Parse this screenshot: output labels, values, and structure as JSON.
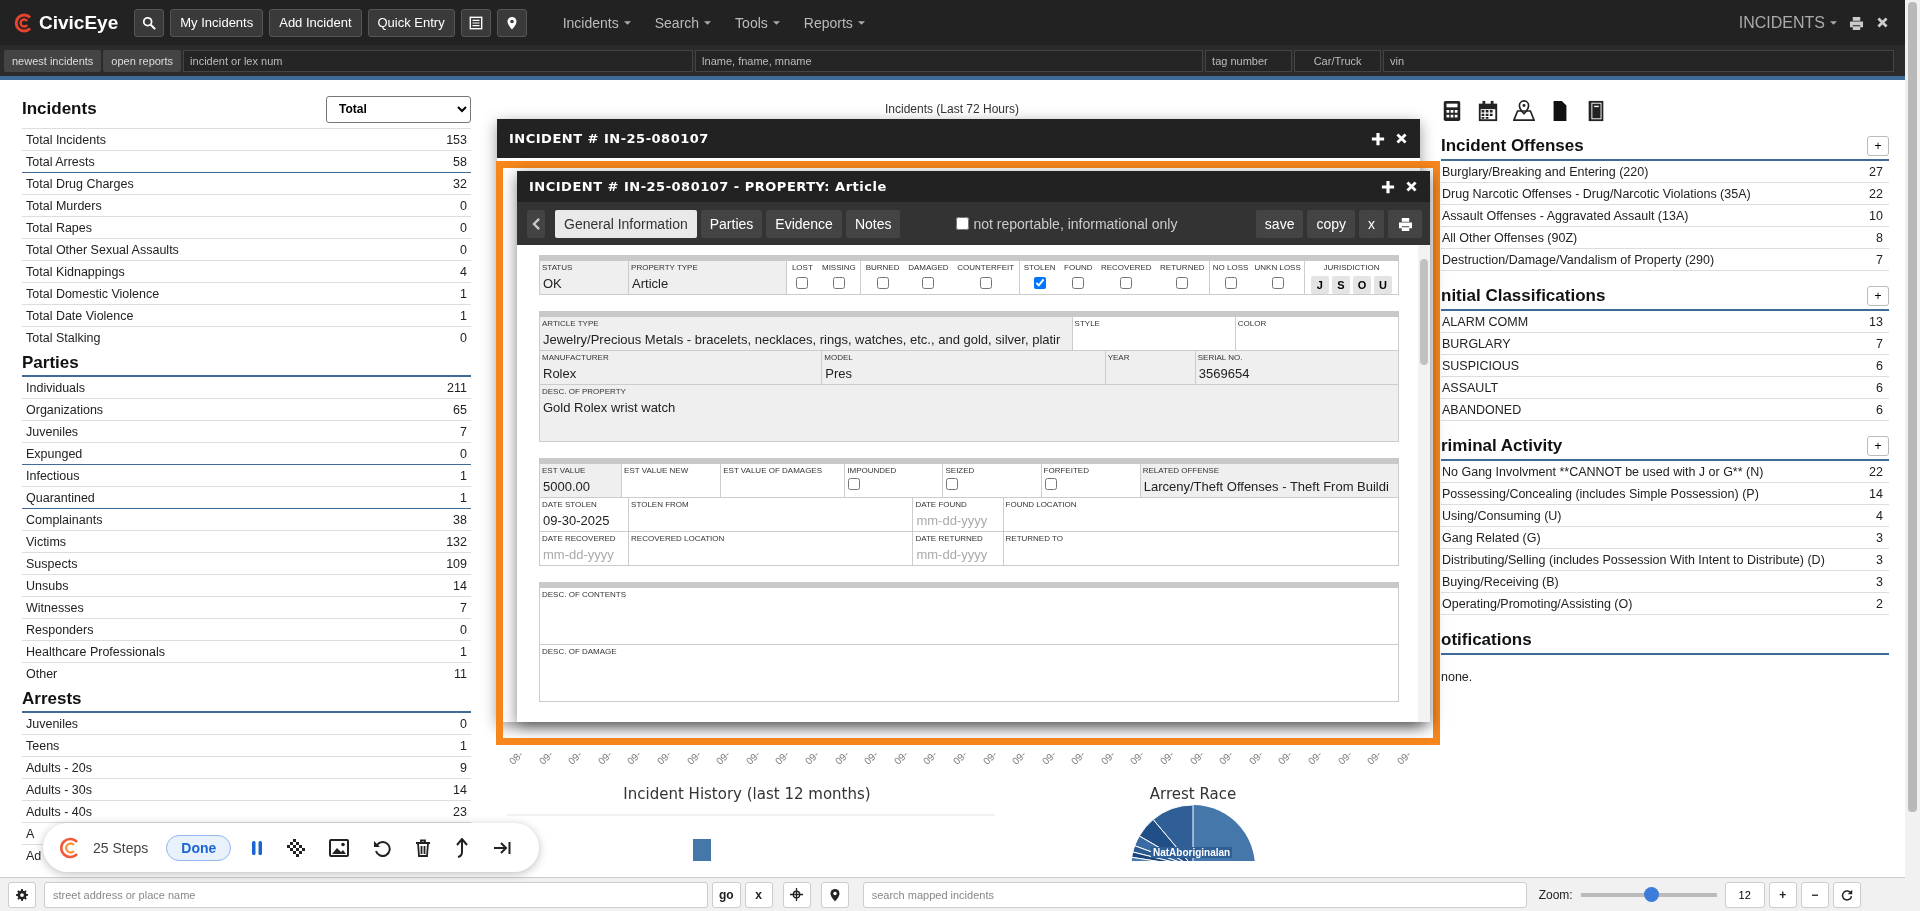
{
  "nav": {
    "logo": "CivicEye",
    "buttons": [
      "My Incidents",
      "Add Incident",
      "Quick Entry"
    ],
    "menus": [
      "Incidents",
      "Search",
      "Tools",
      "Reports"
    ],
    "module": "INCIDENTS"
  },
  "quick_search": {
    "buttons": [
      "newest incidents",
      "open reports"
    ],
    "fields": [
      {
        "placeholder": "incident or lex num"
      },
      {
        "placeholder": "lname, fname, mname"
      },
      {
        "placeholder": "tag number"
      },
      {
        "placeholder": "Car/Truck"
      },
      {
        "placeholder": "vin"
      }
    ]
  },
  "left_panel": {
    "sections": [
      {
        "title": "Incidents",
        "select": "Total",
        "underlined": false,
        "groups": [
          [
            {
              "label": "Total Incidents",
              "value": "153"
            },
            {
              "label": "Total Arrests",
              "value": "58"
            }
          ],
          [
            {
              "label": "Total Drug Charges",
              "value": "32"
            },
            {
              "label": "Total Murders",
              "value": "0"
            },
            {
              "label": "Total Rapes",
              "value": "0"
            },
            {
              "label": "Total Other Sexual Assaults",
              "value": "0"
            },
            {
              "label": "Total Kidnappings",
              "value": "4"
            },
            {
              "label": "Total Domestic Violence",
              "value": "1"
            },
            {
              "label": "Total Date Violence",
              "value": "1"
            },
            {
              "label": "Total Stalking",
              "value": "0"
            }
          ]
        ]
      },
      {
        "title": "Parties",
        "underlined": true,
        "groups": [
          [
            {
              "label": "Individuals",
              "value": "211"
            },
            {
              "label": "Organizations",
              "value": "65"
            },
            {
              "label": "Juveniles",
              "value": "7"
            },
            {
              "label": "Expunged",
              "value": "0"
            }
          ],
          [
            {
              "label": "Infectious",
              "value": "1"
            },
            {
              "label": "Quarantined",
              "value": "1"
            }
          ],
          [
            {
              "label": "Complainants",
              "value": "38"
            },
            {
              "label": "Victims",
              "value": "132"
            },
            {
              "label": "Suspects",
              "value": "109"
            },
            {
              "label": "Unsubs",
              "value": "14"
            },
            {
              "label": "Witnesses",
              "value": "7"
            },
            {
              "label": "Responders",
              "value": "0"
            },
            {
              "label": "Healthcare Professionals",
              "value": "1"
            },
            {
              "label": "Other",
              "value": "11"
            }
          ]
        ]
      },
      {
        "title": "Arrests",
        "underlined": true,
        "groups": [
          [
            {
              "label": "Juveniles",
              "value": "0"
            },
            {
              "label": "Teens",
              "value": "1"
            },
            {
              "label": "Adults - 20s",
              "value": "9"
            },
            {
              "label": "Adults - 30s",
              "value": "14"
            },
            {
              "label": "Adults - 40s",
              "value": "23"
            },
            {
              "label": "A"
            },
            {
              "label": "Ad"
            }
          ]
        ]
      }
    ]
  },
  "center": {
    "chart_title": "Incidents (Last 72 Hours)",
    "x_labels": [
      "08-",
      "09-",
      "09-",
      "09-",
      "09-",
      "09-",
      "09-",
      "09-",
      "09-",
      "09-",
      "09-",
      "09-",
      "09-",
      "09-",
      "09-",
      "09-",
      "09-",
      "09-",
      "09-",
      "09-",
      "09-",
      "09-",
      "09-",
      "09-",
      "09-",
      "09-",
      "09-",
      "09-",
      "09-",
      "09-",
      "09-"
    ],
    "history_title": "Incident History (last 12 months)",
    "race_title": "Arrest Race",
    "race_label": "NatAboriginalan"
  },
  "right_panel": {
    "sections": [
      {
        "title": "Incident Offenses",
        "add": "+",
        "rows": [
          {
            "label": "Burglary/Breaking and Entering (220)",
            "value": "27"
          },
          {
            "label": "Drug Narcotic Offenses - Drug/Narcotic Violations (35A)",
            "value": "22"
          },
          {
            "label": "Assault Offenses - Aggravated Assault (13A)",
            "value": "10"
          },
          {
            "label": "All Other Offenses (90Z)",
            "value": "8"
          },
          {
            "label": "Destruction/Damage/Vandalism of Property (290)",
            "value": "7"
          }
        ]
      },
      {
        "title": "nitial Classifications",
        "add": "+",
        "rows": [
          {
            "label": "ALARM COMM",
            "value": "13"
          },
          {
            "label": "BURGLARY",
            "value": "7"
          },
          {
            "label": "SUSPICIOUS",
            "value": "6"
          },
          {
            "label": "ASSAULT",
            "value": "6"
          },
          {
            "label": "ABANDONED",
            "value": "6"
          }
        ]
      },
      {
        "title": "riminal Activity",
        "add": "+",
        "rows": [
          {
            "label": "No Gang Involvment **CANNOT be used with J or G** (N)",
            "value": "22"
          },
          {
            "label": "Possessing/Concealing (includes Simple Possession) (P)",
            "value": "14"
          },
          {
            "label": "Using/Consuming (U)",
            "value": "4"
          },
          {
            "label": "Gang Related (G)",
            "value": "3"
          },
          {
            "label": "Distributing/Selling (includes Possession With Intent to Distribute) (D)",
            "value": "3"
          },
          {
            "label": "Buying/Receiving (B)",
            "value": "3"
          },
          {
            "label": "Operating/Promoting/Assisting (O)",
            "value": "2"
          }
        ]
      }
    ],
    "notifications": {
      "title": "otifications",
      "text": "none."
    }
  },
  "incident_window": {
    "title": "INCIDENT # IN-25-080107"
  },
  "property_window": {
    "title": "INCIDENT # IN-25-080107 - PROPERTY: Article",
    "tabs": [
      {
        "label": "General Information",
        "selected": true
      },
      {
        "label": "Parties",
        "selected": false
      },
      {
        "label": "Evidence",
        "selected": false
      },
      {
        "label": "Notes",
        "selected": false
      }
    ],
    "not_reportable": {
      "label": "not reportable, informational only",
      "checked": false
    },
    "actions": [
      "save",
      "copy",
      "x"
    ],
    "form": [
      {
        "rows": [
          [
            {
              "kind": "text",
              "label": "STATUS",
              "value": "OK",
              "shaded": true
            },
            {
              "kind": "text",
              "label": "PROPERTY TYPE",
              "value": "Article",
              "shaded": true
            },
            {
              "kind": "checks",
              "items": [
                {
                  "label": "LOST",
                  "checked": false
                },
                {
                  "label": "MISSING",
                  "checked": false
                }
              ]
            },
            {
              "kind": "checks",
              "items": [
                {
                  "label": "BURNED",
                  "checked": false
                },
                {
                  "label": "DAMAGED",
                  "checked": false
                },
                {
                  "label": "COUNTERFEIT",
                  "checked": false
                }
              ]
            },
            {
              "kind": "checks",
              "items": [
                {
                  "label": "STOLEN",
                  "checked": true
                },
                {
                  "label": "FOUND",
                  "checked": false
                },
                {
                  "label": "RECOVERED",
                  "checked": false
                },
                {
                  "label": "RETURNED",
                  "checked": false
                }
              ]
            },
            {
              "kind": "checks",
              "items": [
                {
                  "label": "NO LOSS",
                  "checked": false
                },
                {
                  "label": "UNKN LOSS",
                  "checked": false
                }
              ]
            },
            {
              "kind": "buttons",
              "label": "JURISDICTION",
              "buttons": [
                "J",
                "S",
                "O",
                "U"
              ]
            }
          ]
        ]
      },
      {
        "rows": [
          [
            {
              "kind": "text",
              "label": "ARTICLE TYPE",
              "value": "Jewelry/Precious Metals - bracelets, necklaces, rings, watches, etc., and gold, silver, platir",
              "shaded": true
            },
            {
              "kind": "text",
              "label": "STYLE",
              "shaded": false
            },
            {
              "kind": "text",
              "label": "COLOR",
              "shaded": false
            }
          ],
          [
            {
              "kind": "text",
              "label": "MANUFACTURER",
              "value": "Rolex",
              "shaded": true
            },
            {
              "kind": "text",
              "label": "MODEL",
              "value": "Pres",
              "shaded": true
            },
            {
              "kind": "text",
              "label": "YEAR",
              "shaded": true
            },
            {
              "kind": "text",
              "label": "SERIAL NO.",
              "value": "3569654",
              "shaded": true
            }
          ],
          [
            {
              "kind": "area",
              "label": "DESC. OF PROPERTY",
              "value": "Gold Rolex wrist watch",
              "shaded": true
            }
          ]
        ]
      },
      {
        "rows": [
          [
            {
              "kind": "text",
              "label": "EST VALUE",
              "value": "5000.00",
              "shaded": true
            },
            {
              "kind": "text",
              "label": "EST VALUE NEW",
              "shaded": false
            },
            {
              "kind": "text",
              "label": "EST VALUE OF DAMAGES",
              "shaded": false
            },
            {
              "kind": "check",
              "label": "IMPOUNDED",
              "checked": false
            },
            {
              "kind": "check",
              "label": "SEIZED",
              "checked": false
            },
            {
              "kind": "check",
              "label": "FORFEITED",
              "checked": false
            },
            {
              "kind": "text",
              "label": "RELATED OFFENSE",
              "value": "Larceny/Theft Offenses - Theft From Buildi",
              "shaded": true
            }
          ],
          [
            {
              "kind": "text",
              "label": "DATE STOLEN",
              "value": "09-30-2025",
              "shaded": false
            },
            {
              "kind": "text",
              "label": "STOLEN FROM",
              "shaded": false
            },
            {
              "kind": "text",
              "label": "DATE FOUND",
              "placeholder": "mm-dd-yyyy",
              "shaded": false
            },
            {
              "kind": "text",
              "label": "FOUND LOCATION",
              "shaded": false
            }
          ],
          [
            {
              "kind": "text",
              "label": "DATE RECOVERED",
              "placeholder": "mm-dd-yyyy",
              "shaded": false
            },
            {
              "kind": "text",
              "label": "RECOVERED LOCATION",
              "shaded": false
            },
            {
              "kind": "text",
              "label": "DATE RETURNED",
              "placeholder": "mm-dd-yyyy",
              "shaded": false
            },
            {
              "kind": "text",
              "label": "RETURNED TO",
              "shaded": false
            }
          ]
        ]
      },
      {
        "rows": [
          [
            {
              "kind": "area",
              "label": "DESC. OF CONTENTS",
              "shaded": false
            }
          ],
          [
            {
              "kind": "area",
              "label": "DESC. OF DAMAGE",
              "shaded": false
            }
          ]
        ]
      }
    ]
  },
  "step_recorder": {
    "steps": "25 Steps",
    "done": "Done"
  },
  "map_bar": {
    "address_placeholder": "street address or place name",
    "go": "go",
    "clear": "x",
    "search_placeholder": "search mapped incidents",
    "zoom_label": "Zoom:",
    "zoom": {
      "level": 0.52
    },
    "zoom_value": "12",
    "zoom_in": "+",
    "zoom_out": "−"
  }
}
